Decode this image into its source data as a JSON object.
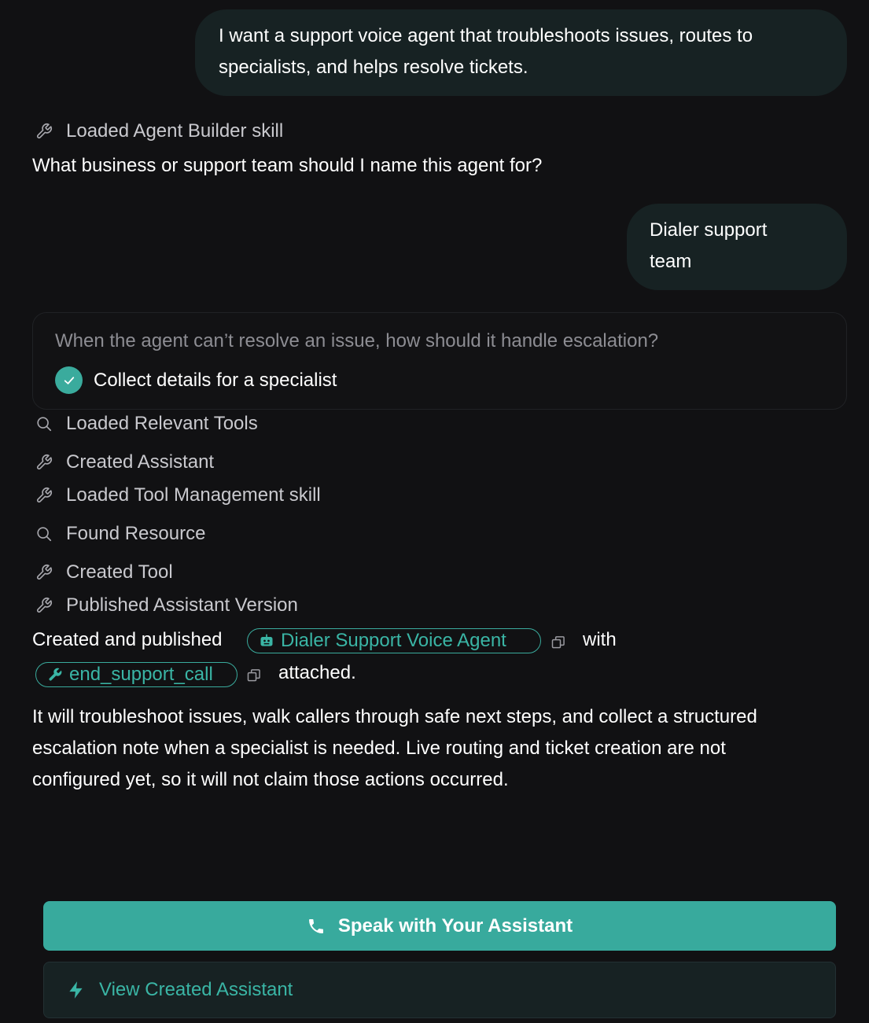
{
  "conversation": {
    "user_message_1": {
      "line1": "I want a support voice agent that troubleshoots issues, routes to",
      "line2": "specialists, and helps resolve tickets."
    },
    "step_loaded_skill": {
      "icon": "wrench-icon",
      "label": "Loaded Agent Builder skill"
    },
    "assistant_question": "What business or support team should I name this agent for?",
    "user_message_2": {
      "line1": "Dialer support",
      "line2": "team"
    },
    "escalation_card": {
      "question": "When the agent can’t resolve an issue, how should it handle escalation?",
      "answer": "Collect details for a specialist",
      "answer_icon": "check-circle-icon"
    },
    "steps": [
      {
        "icon": "search-icon",
        "label": "Loaded Relevant Tools"
      },
      {
        "icon": "wrench-icon",
        "label": "Created Assistant"
      },
      {
        "icon": "wrench-icon",
        "label": "Loaded Tool Management skill"
      },
      {
        "icon": "search-icon",
        "label": "Found Resource"
      },
      {
        "icon": "wrench-icon",
        "label": "Created Tool"
      },
      {
        "icon": "wrench-icon",
        "label": "Published Assistant Version"
      }
    ],
    "summary": {
      "prefix": "Created and published",
      "assistant_chip": {
        "icon": "robot-icon",
        "label": "Dialer Support Voice Agent"
      },
      "middle": "with",
      "tool_chip": {
        "icon": "wrench-icon",
        "label": "end_support_call"
      },
      "suffix": "attached."
    },
    "details": {
      "line1": "It will troubleshoot issues, walk callers through safe next steps, and collect a structured",
      "line2": "escalation note when a specialist is needed. Live routing and ticket creation are not",
      "line3": "configured yet, so it will not claim those actions occurred."
    }
  },
  "actions": {
    "speak_button": {
      "icon": "phone-icon",
      "label": "Speak with Your Assistant"
    },
    "view_button": {
      "icon": "lightning-icon",
      "label": "View Created Assistant"
    }
  },
  "colors": {
    "background": "#111113",
    "bubble": "#172223",
    "accent": "#38aa9d",
    "muted_text": "#8d8d93"
  }
}
